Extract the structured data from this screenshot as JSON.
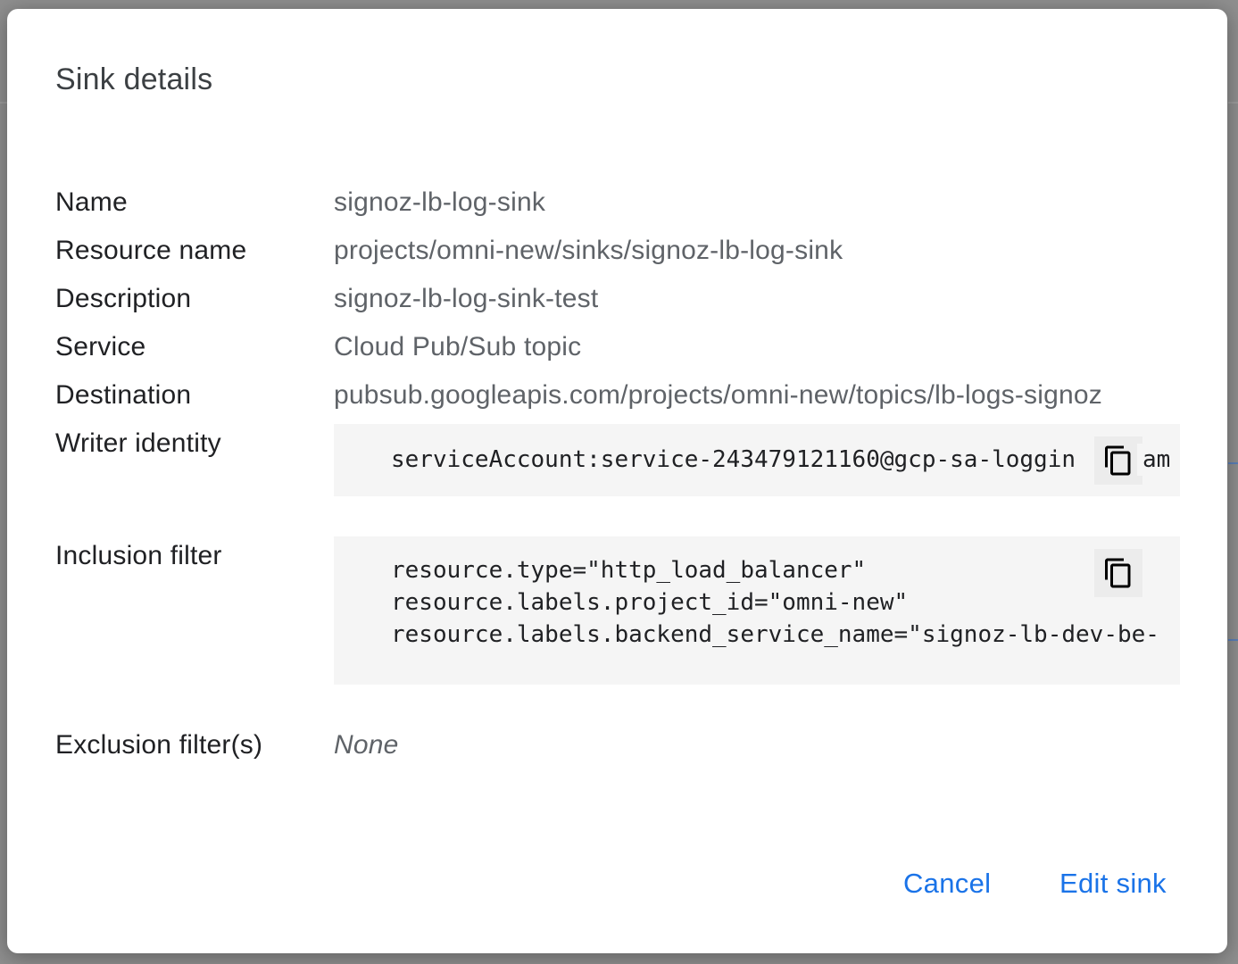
{
  "dialog": {
    "title": "Sink details"
  },
  "details": {
    "name_label": "Name",
    "name_value": "signoz-lb-log-sink",
    "resource_label": "Resource name",
    "resource_value": "projects/omni-new/sinks/signoz-lb-log-sink",
    "description_label": "Description",
    "description_value": "signoz-lb-log-sink-test",
    "service_label": "Service",
    "service_value": "Cloud Pub/Sub topic",
    "destination_label": "Destination",
    "destination_value": "pubsub.googleapis.com/projects/omni-new/topics/lb-logs-signoz",
    "writer_label": "Writer identity",
    "writer_value": "serviceAccount:service-243479121160@gcp-sa-loggin",
    "writer_value_tail": "am",
    "inclusion_label": "Inclusion filter",
    "inclusion_lines": [
      "resource.type=\"http_load_balancer\"",
      "resource.labels.project_id=\"omni-new\"",
      "resource.labels.backend_service_name=\"signoz-lb-dev-be-"
    ],
    "exclusion_label": "Exclusion filter(s)",
    "exclusion_value": "None"
  },
  "actions": {
    "cancel_label": "Cancel",
    "edit_label": "Edit sink"
  },
  "colors": {
    "accent": "#1a73e8",
    "code_bg": "#f5f5f5"
  },
  "icons": {
    "copy": "copy-icon"
  }
}
